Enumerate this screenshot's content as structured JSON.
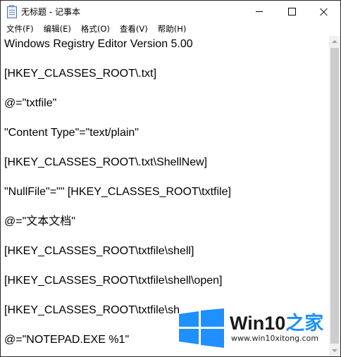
{
  "window": {
    "title": "无标题 - 记事本",
    "icon": "notepad-icon"
  },
  "title_buttons": {
    "minimize": "minimize-icon",
    "maximize": "maximize-icon",
    "close": "close-icon"
  },
  "menu": [
    {
      "label": "文件(F)"
    },
    {
      "label": "编辑(E)"
    },
    {
      "label": "格式(O)"
    },
    {
      "label": "查看(V)"
    },
    {
      "label": "帮助(H)"
    }
  ],
  "editor": {
    "lines": [
      "Windows Registry Editor Version 5.00",
      "[HKEY_CLASSES_ROOT\\.txt]",
      "@=\"txtfile\"",
      "\"Content Type\"=\"text/plain\"",
      "[HKEY_CLASSES_ROOT\\.txt\\ShellNew]",
      "\"NullFile\"=\"\" [HKEY_CLASSES_ROOT\\txtfile]",
      "@=\"文本文档\"",
      "[HKEY_CLASSES_ROOT\\txtfile\\shell]",
      "[HKEY_CLASSES_ROOT\\txtfile\\shell\\open]",
      "[HKEY_CLASSES_ROOT\\txtfile\\sh",
      "@=\"NOTEPAD.EXE %1\""
    ]
  },
  "watermark": {
    "brand_prefix": "Win10",
    "brand_suffix": "之家",
    "url": "www.win10xitong.com",
    "logo": "windows-logo",
    "accent_color": "#1e90ff"
  }
}
